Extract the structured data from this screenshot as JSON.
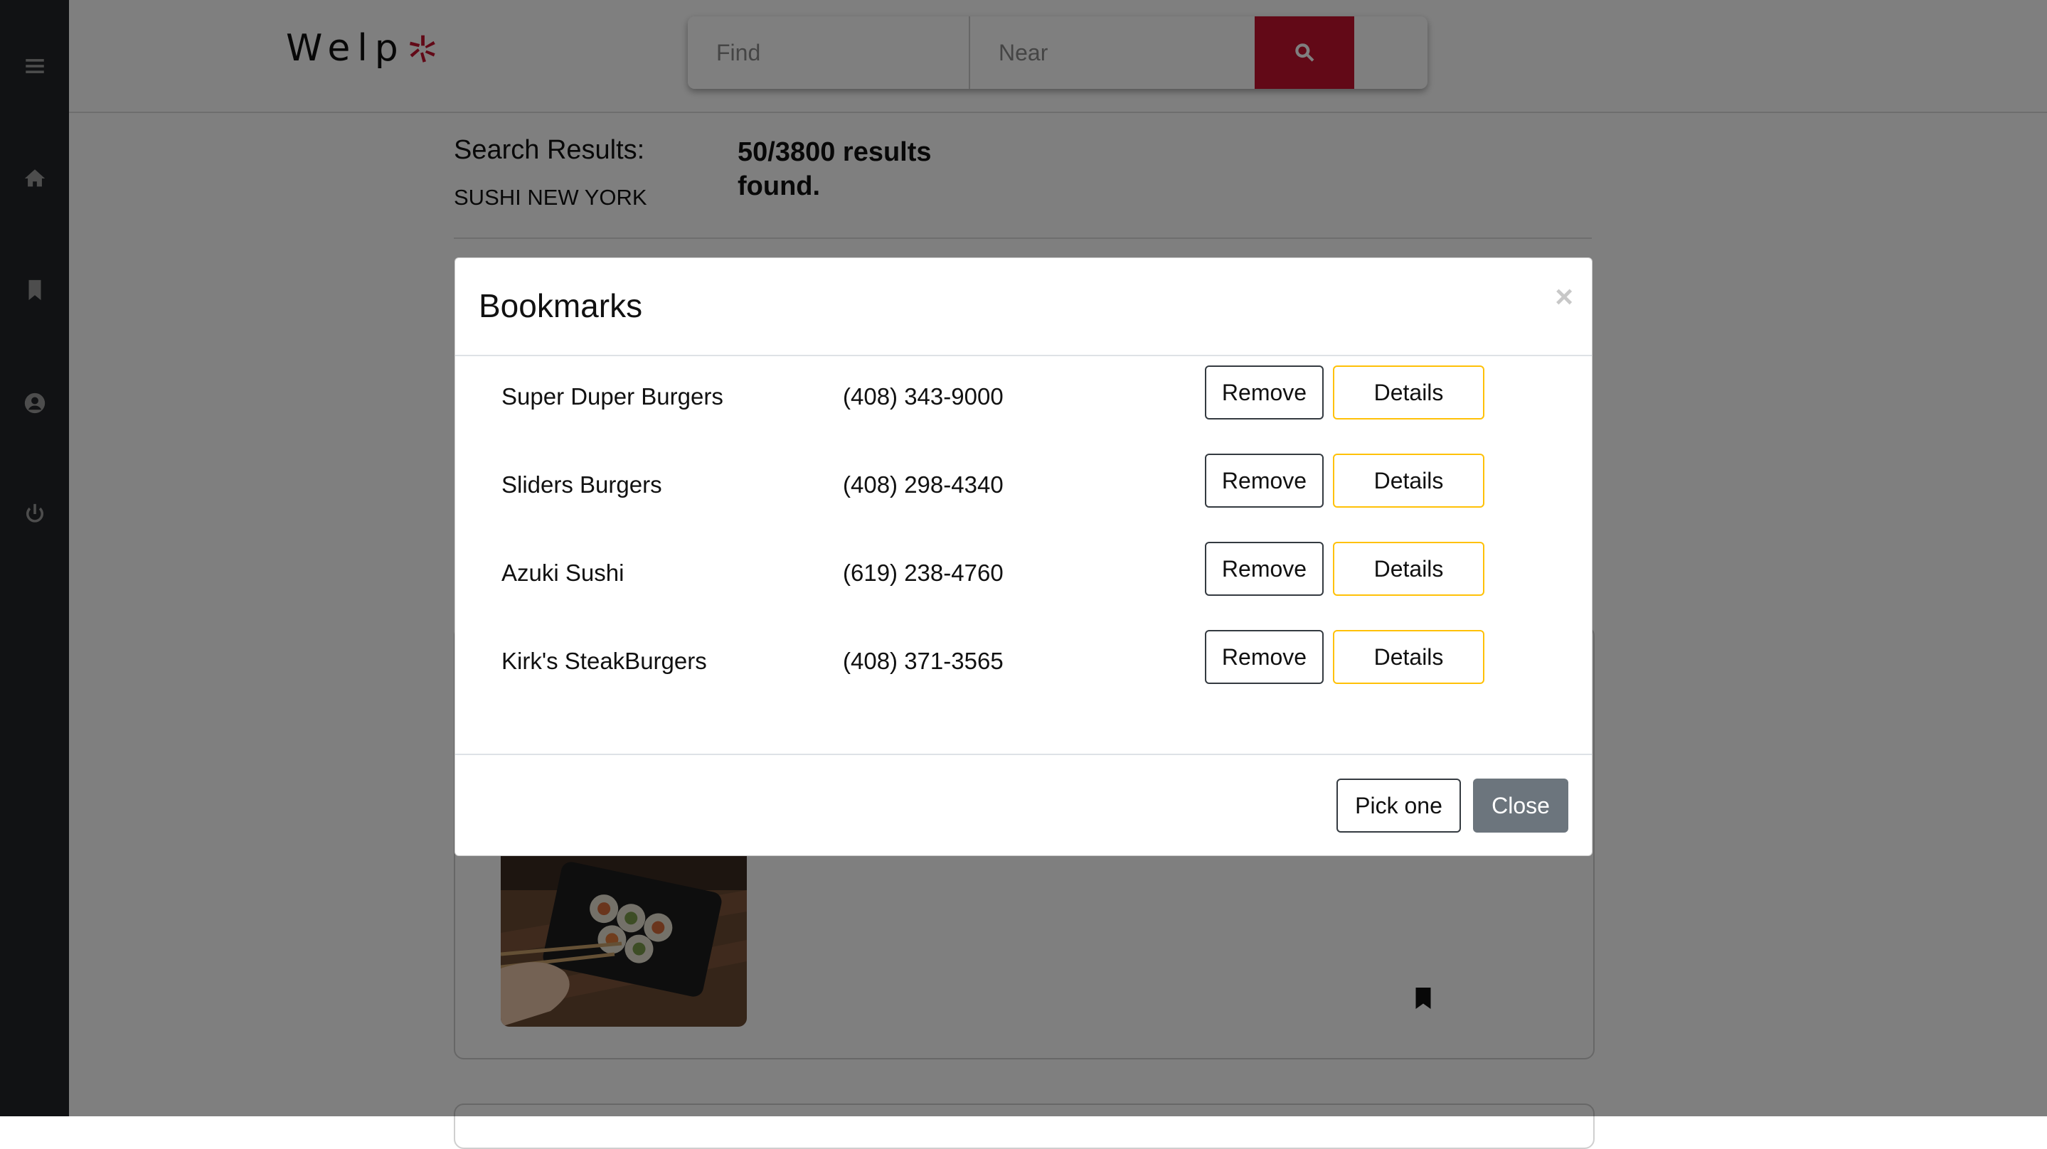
{
  "app": {
    "logo_text": "Welp"
  },
  "sidebar": {
    "items": [
      {
        "icon": "menu-icon"
      },
      {
        "icon": "home-icon"
      },
      {
        "icon": "bookmark-icon"
      },
      {
        "icon": "user-icon"
      },
      {
        "icon": "power-icon"
      }
    ]
  },
  "search": {
    "find_placeholder": "Find",
    "near_placeholder": "Near",
    "button_icon": "search-icon"
  },
  "results": {
    "title": "Search Results:",
    "query": "SUSHI NEW YORK",
    "count": "50/3800 results found."
  },
  "modal": {
    "title": "Bookmarks",
    "close_icon": "×",
    "bookmarks": [
      {
        "name": "Super Duper Burgers",
        "phone": "(408) 343-9000"
      },
      {
        "name": "Sliders Burgers",
        "phone": "(408) 298-4340"
      },
      {
        "name": "Azuki Sushi",
        "phone": "(619) 238-4760"
      },
      {
        "name": "Kirk's SteakBurgers",
        "phone": "(408) 371-3565"
      }
    ],
    "remove_label": "Remove",
    "details_label": "Details",
    "pick_label": "Pick one",
    "close_label": "Close"
  },
  "colors": {
    "brand_red": "#c4122f",
    "sidebar_bg": "#222528",
    "details_border": "#ffc107",
    "close_btn": "#6c757d"
  }
}
